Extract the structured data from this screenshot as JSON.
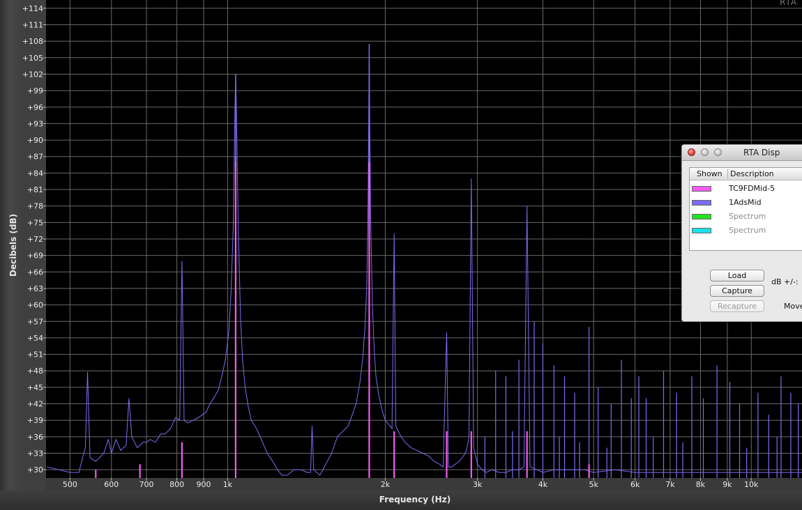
{
  "window": {
    "corner_title": "RTA"
  },
  "chart_data": {
    "type": "line",
    "title": "",
    "xlabel": "Frequency (Hz)",
    "ylabel": "Decibels (dB)",
    "x_scale": "log",
    "xlim": [
      450,
      12500
    ],
    "ylim": [
      28.5,
      115.5
    ],
    "grid": true,
    "x_ticks": [
      {
        "value": 500,
        "label": "500"
      },
      {
        "value": 600,
        "label": "600"
      },
      {
        "value": 700,
        "label": "700"
      },
      {
        "value": 800,
        "label": "800"
      },
      {
        "value": 900,
        "label": "900"
      },
      {
        "value": 1000,
        "label": "1k"
      },
      {
        "value": 2000,
        "label": "2k"
      },
      {
        "value": 3000,
        "label": "3k"
      },
      {
        "value": 4000,
        "label": "4k"
      },
      {
        "value": 5000,
        "label": "5k"
      },
      {
        "value": 6000,
        "label": "6k"
      },
      {
        "value": 7000,
        "label": "7k"
      },
      {
        "value": 8000,
        "label": "8k"
      },
      {
        "value": 9000,
        "label": "9k"
      },
      {
        "value": 10000,
        "label": "10k"
      }
    ],
    "y_ticks": [
      {
        "value": 30,
        "label": "+30"
      },
      {
        "value": 33,
        "label": "+33"
      },
      {
        "value": 36,
        "label": "+36"
      },
      {
        "value": 39,
        "label": "+39"
      },
      {
        "value": 42,
        "label": "+42"
      },
      {
        "value": 45,
        "label": "+45"
      },
      {
        "value": 48,
        "label": "+48"
      },
      {
        "value": 51,
        "label": "+51"
      },
      {
        "value": 54,
        "label": "+54"
      },
      {
        "value": 57,
        "label": "+57"
      },
      {
        "value": 60,
        "label": "+60"
      },
      {
        "value": 63,
        "label": "+63"
      },
      {
        "value": 66,
        "label": "+66"
      },
      {
        "value": 69,
        "label": "+69"
      },
      {
        "value": 72,
        "label": "+72"
      },
      {
        "value": 75,
        "label": "+75"
      },
      {
        "value": 78,
        "label": "+78"
      },
      {
        "value": 81,
        "label": "+81"
      },
      {
        "value": 84,
        "label": "+84"
      },
      {
        "value": 87,
        "label": "+87"
      },
      {
        "value": 90,
        "label": "+90"
      },
      {
        "value": 93,
        "label": "+93"
      },
      {
        "value": 96,
        "label": "+96"
      },
      {
        "value": 99,
        "label": "+99"
      },
      {
        "value": 102,
        "label": "+102"
      },
      {
        "value": 105,
        "label": "+105"
      },
      {
        "value": 108,
        "label": "+108"
      },
      {
        "value": 111,
        "label": "+111"
      },
      {
        "value": 114,
        "label": "+114"
      }
    ],
    "series": [
      {
        "name": "1AdsMid",
        "color": "#7b6cf5",
        "points": [
          [
            452,
            30.5
          ],
          [
            500,
            29.5
          ],
          [
            520,
            29.5
          ],
          [
            528,
            32
          ],
          [
            535,
            34
          ],
          [
            540,
            47.8
          ],
          [
            546,
            32.2
          ],
          [
            560,
            31.5
          ],
          [
            580,
            33
          ],
          [
            592,
            35.5
          ],
          [
            600,
            33
          ],
          [
            612,
            35.5
          ],
          [
            625,
            33.5
          ],
          [
            640,
            34.5
          ],
          [
            648,
            43
          ],
          [
            656,
            36
          ],
          [
            672,
            34
          ],
          [
            690,
            35
          ],
          [
            700,
            35
          ],
          [
            712,
            35.5
          ],
          [
            728,
            35
          ],
          [
            745,
            36.5
          ],
          [
            760,
            36.5
          ],
          [
            778,
            37.5
          ],
          [
            795,
            39.5
          ],
          [
            810,
            39
          ],
          [
            818,
            68
          ],
          [
            826,
            39
          ],
          [
            840,
            38.5
          ],
          [
            860,
            39
          ],
          [
            880,
            39.5
          ],
          [
            895,
            40
          ],
          [
            910,
            40.5
          ],
          [
            925,
            42
          ],
          [
            940,
            43
          ],
          [
            960,
            44.5
          ],
          [
            975,
            47
          ],
          [
            990,
            50
          ],
          [
            1005,
            55
          ],
          [
            1015,
            62
          ],
          [
            1025,
            74
          ],
          [
            1032,
            94
          ],
          [
            1036,
            102
          ],
          [
            1040,
            94
          ],
          [
            1048,
            74
          ],
          [
            1058,
            58
          ],
          [
            1068,
            50
          ],
          [
            1080,
            45
          ],
          [
            1095,
            41.5
          ],
          [
            1110,
            39
          ],
          [
            1135,
            37.5
          ],
          [
            1160,
            35.5
          ],
          [
            1190,
            33
          ],
          [
            1220,
            31.5
          ],
          [
            1245,
            30
          ],
          [
            1270,
            29
          ],
          [
            1300,
            29
          ],
          [
            1340,
            30
          ],
          [
            1380,
            30
          ],
          [
            1420,
            29.5
          ],
          [
            1440,
            29.5
          ],
          [
            1450,
            38
          ],
          [
            1460,
            30
          ],
          [
            1500,
            29
          ],
          [
            1540,
            31
          ],
          [
            1580,
            33
          ],
          [
            1620,
            36
          ],
          [
            1660,
            37
          ],
          [
            1700,
            38
          ],
          [
            1730,
            40
          ],
          [
            1760,
            42
          ],
          [
            1790,
            46
          ],
          [
            1810,
            50
          ],
          [
            1830,
            56
          ],
          [
            1845,
            64
          ],
          [
            1855,
            80
          ],
          [
            1860,
            94
          ],
          [
            1864,
            107.5
          ],
          [
            1868,
            94
          ],
          [
            1876,
            76
          ],
          [
            1890,
            60
          ],
          [
            1905,
            52
          ],
          [
            1920,
            47
          ],
          [
            1940,
            44
          ],
          [
            1970,
            41
          ],
          [
            2000,
            39
          ],
          [
            2040,
            38
          ],
          [
            2060,
            37.5
          ],
          [
            2080,
            73
          ],
          [
            2095,
            38
          ],
          [
            2130,
            36.5
          ],
          [
            2180,
            35
          ],
          [
            2240,
            34
          ],
          [
            2300,
            33.5
          ],
          [
            2360,
            33
          ],
          [
            2420,
            32.5
          ],
          [
            2480,
            31.5
          ],
          [
            2540,
            31
          ],
          [
            2580,
            30.5
          ],
          [
            2620,
            55
          ],
          [
            2640,
            30.5
          ],
          [
            2680,
            30.5
          ],
          [
            2720,
            31
          ],
          [
            2770,
            31.5
          ],
          [
            2820,
            32.5
          ],
          [
            2860,
            33.5
          ],
          [
            2890,
            36
          ],
          [
            2920,
            83
          ],
          [
            2950,
            34
          ],
          [
            3000,
            31
          ],
          [
            3060,
            30
          ],
          [
            3120,
            29.5
          ],
          [
            3200,
            30
          ],
          [
            3300,
            29.5
          ],
          [
            3400,
            29.5
          ],
          [
            3500,
            30
          ],
          [
            3600,
            30
          ],
          [
            3680,
            30.5
          ],
          [
            3730,
            78
          ],
          [
            3780,
            30.5
          ],
          [
            3900,
            30
          ],
          [
            4000,
            29.5
          ],
          [
            4200,
            30
          ],
          [
            4500,
            30
          ],
          [
            4800,
            30
          ],
          [
            5000,
            29.5
          ],
          [
            5500,
            30
          ],
          [
            6000,
            29.5
          ],
          [
            7000,
            29.5
          ],
          [
            8000,
            29.5
          ],
          [
            9000,
            29.5
          ],
          [
            10000,
            29.5
          ],
          [
            11000,
            29.5
          ],
          [
            12500,
            29.5
          ]
        ],
        "lines": [
          [
            3250,
            48
          ],
          [
            3400,
            47
          ],
          [
            3600,
            50
          ],
          [
            3850,
            57
          ],
          [
            4000,
            53
          ],
          [
            4200,
            49
          ],
          [
            4400,
            47
          ],
          [
            4600,
            44
          ],
          [
            4900,
            56
          ],
          [
            5100,
            45
          ],
          [
            5400,
            42
          ],
          [
            5650,
            50
          ],
          [
            5900,
            43
          ],
          [
            6100,
            47
          ],
          [
            6300,
            43
          ],
          [
            6800,
            48
          ],
          [
            7200,
            44
          ],
          [
            7700,
            47
          ],
          [
            8100,
            43
          ],
          [
            8600,
            49
          ],
          [
            9100,
            46
          ],
          [
            9500,
            42
          ],
          [
            10300,
            44
          ],
          [
            10800,
            40
          ],
          [
            11400,
            47
          ],
          [
            11900,
            44
          ],
          [
            12300,
            42
          ],
          [
            3100,
            36
          ],
          [
            3500,
            37
          ],
          [
            4300,
            36
          ],
          [
            4700,
            35
          ],
          [
            5300,
            34
          ],
          [
            6500,
            36
          ],
          [
            7400,
            35
          ],
          [
            9800,
            34
          ],
          [
            11200,
            36
          ]
        ]
      },
      {
        "name": "TC9FDMid-5",
        "color": "#f25cf0",
        "lines": [
          [
            1036,
            87
          ],
          [
            1864,
            86
          ],
          [
            818,
            35
          ],
          [
            2080,
            37
          ],
          [
            2620,
            37
          ],
          [
            2920,
            37
          ],
          [
            3730,
            37
          ],
          [
            4900,
            31
          ],
          [
            680,
            31
          ],
          [
            560,
            30
          ]
        ]
      }
    ]
  },
  "legend_dialog": {
    "title": "RTA Disp",
    "columns": {
      "shown": "Shown",
      "description": "Description"
    },
    "rows": [
      {
        "description": "TC9FDMid-5",
        "color": "#f25cf0",
        "enabled": true
      },
      {
        "description": "1AdsMid",
        "color": "#7b6cf5",
        "enabled": true
      },
      {
        "description": "Spectrum",
        "color": "#22e022",
        "enabled": false
      },
      {
        "description": "Spectrum",
        "color": "#1ee0e8",
        "enabled": false
      }
    ],
    "buttons": {
      "load": "Load",
      "capture": "Capture",
      "recapture": "Recapture"
    },
    "db_label": "dB +/-:",
    "move_label": "Move"
  }
}
